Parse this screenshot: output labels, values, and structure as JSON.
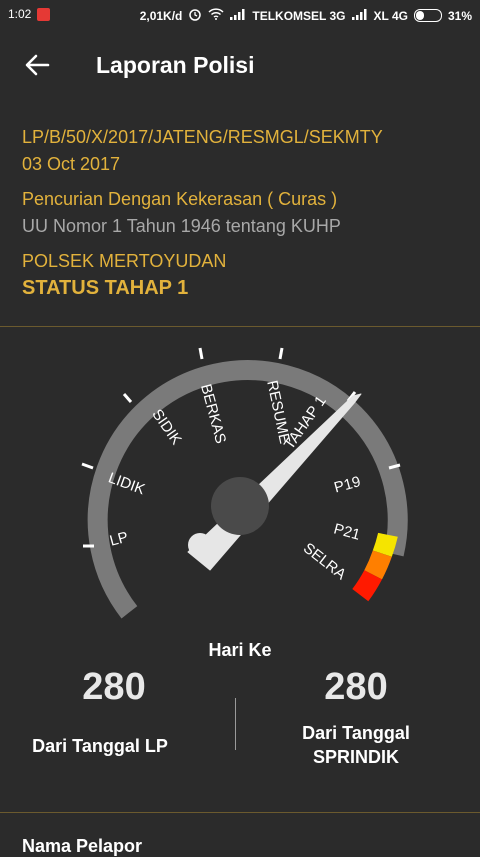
{
  "status_bar": {
    "time": "1:02",
    "speed": "2,01K/d",
    "carrier1": "TELKOMSEL 3G",
    "carrier2": "XL 4G",
    "battery": "31%"
  },
  "appbar": {
    "title": "Laporan Polisi"
  },
  "report": {
    "number": "LP/B/50/X/2017/JATENG/RESMGL/SEKMTY",
    "date": "03 Oct 2017",
    "crime": "Pencurian Dengan Kekerasan ( Curas )",
    "law": "UU Nomor 1 Tahun 1946 tentang KUHP",
    "station": "POLSEK MERTOYUDAN",
    "status": "STATUS TAHAP 1"
  },
  "gauge": {
    "stages": [
      "LP",
      "LIDIK",
      "SIDIK",
      "BERKAS",
      "RESUME",
      "TAHAP 1",
      "P19",
      "P21",
      "SELRA"
    ],
    "current_stage": "TAHAP 1",
    "colors": {
      "track": "#7a7a7a",
      "needle": "#e6e6e6",
      "hub": "#4a4a4a",
      "yellow": "#f5e400",
      "orange": "#ff7f00",
      "red": "#ff1a00"
    }
  },
  "days": {
    "label": "Hari Ke",
    "from_lp_value": "280",
    "from_lp_label": "Dari Tanggal LP",
    "from_sprindik_value": "280",
    "from_sprindik_label_1": "Dari Tanggal",
    "from_sprindik_label_2": "SPRINDIK"
  },
  "reporter": {
    "label": "Nama Pelapor"
  }
}
